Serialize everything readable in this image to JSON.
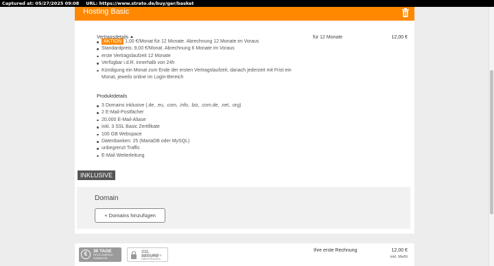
{
  "capture": {
    "captured_at": "Captured at: 05/27/2025 09:08",
    "url": "URL: https://www.strato.de/buy/ger/basket"
  },
  "product": {
    "title": "Hosting Basic",
    "delete_icon": "trash-icon",
    "contract_label": "Vertragsdetails",
    "term": "für 12 Monate",
    "price": "12,00 €",
    "aktion_badge": "AKTION",
    "contract_details": [
      "1,00 €/Monat für 12 Monate. Abrechnung 12 Monate im Voraus",
      "Standardpreis: 9,00 €/Monat. Abrechnung 6 Monate im Voraus",
      "erste Vertragslaufzeit 12 Monate",
      "Verfügbar i.d.R. innerhalb von 24h",
      "Kündigung ein Monat zum Ende der ersten Vertragslaufzeit, danach jederzeit mit Frist ein",
      "Monat, jeweils online im Login-Bereich"
    ],
    "product_details_title": "Produktdetails",
    "product_details": [
      "3 Domains inklusive (.de, .eu, .com, .info, .biz, .com.de, .net, .org)",
      "2 E-Mail-Postfächer",
      "20.000 E-Mail-Aliase",
      "inkl. 3 SSL Basic Zertifikate",
      "100 GB Webspace",
      "Datenbanken: 25 (MariaDB oder MySQL)",
      "unbegrenzt Traffic",
      "E-Mail Weiterleitung"
    ],
    "inklusive_label": "INKLUSIVE",
    "domain_title": "Domain",
    "add_domains_button": "+ Domains hinzufügen"
  },
  "summary": {
    "badge_guarantee_title": "30 TAGE",
    "badge_guarantee_text": "GELD-ZURÜCK GARANTIE",
    "badge_ssl_title": "SSL SECURE",
    "badge_ssl_text": "DATEN SICHER ÜBERTRAGEN",
    "first_invoice_label": "Ihre erste Rechnung",
    "first_invoice_price": "12,00 €",
    "vat_note": "inkl. MwSt"
  },
  "colors": {
    "accent": "#ff8800",
    "inklusive_bg": "#555555"
  }
}
